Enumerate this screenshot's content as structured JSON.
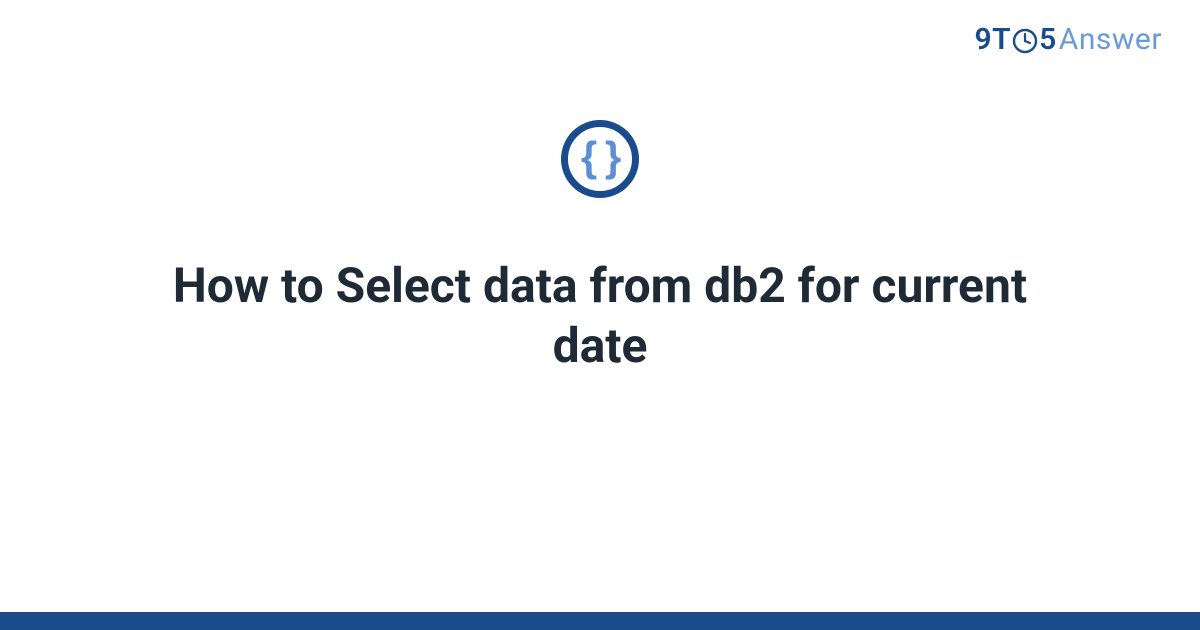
{
  "logo": {
    "nine": "9",
    "t": "T",
    "five": "5",
    "answer": "Answer"
  },
  "badge": {
    "braces": "{ }"
  },
  "title": "How to Select data from db2 for current date",
  "colors": {
    "brand_primary": "#1a4b8c",
    "brand_secondary": "#6a9bd8",
    "text": "#1f2a37"
  }
}
